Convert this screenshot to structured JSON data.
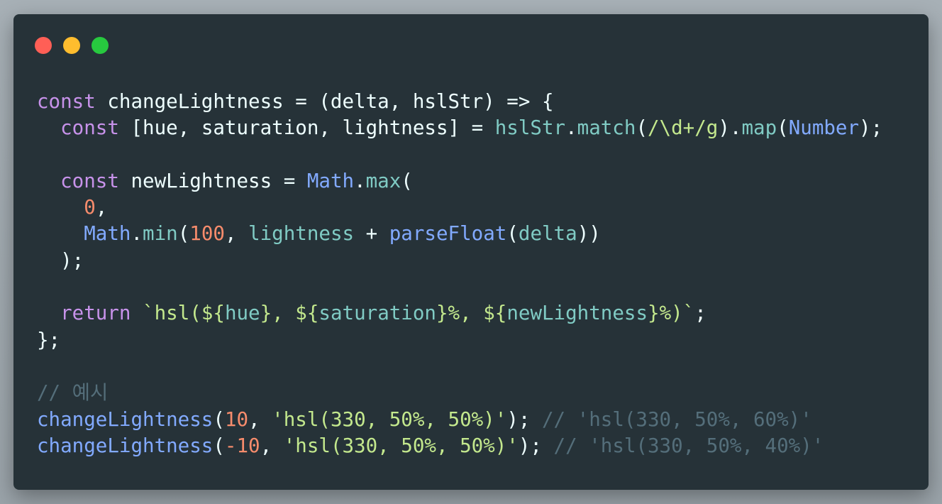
{
  "window": {
    "controls": [
      {
        "name": "close-button",
        "color": "#ff5f56"
      },
      {
        "name": "minimize-button",
        "color": "#ffbd2e"
      },
      {
        "name": "maximize-button",
        "color": "#27c93f"
      }
    ]
  },
  "colors": {
    "background": "#263238",
    "keyword": "#c792ea",
    "builtin": "#82aaff",
    "method": "#80cbc4",
    "number": "#f78c6c",
    "string": "#c3e88d",
    "comment": "#546e7a",
    "plain": "#eeffff"
  },
  "code": {
    "lines": [
      [
        {
          "t": "keyword",
          "v": "const"
        },
        {
          "t": "plain",
          "v": " changeLightness = (delta, hslStr) => {"
        }
      ],
      [
        {
          "t": "plain",
          "v": "  "
        },
        {
          "t": "keyword",
          "v": "const"
        },
        {
          "t": "plain",
          "v": " [hue, saturation, lightness] = "
        },
        {
          "t": "method",
          "v": "hslStr"
        },
        {
          "t": "plain",
          "v": "."
        },
        {
          "t": "method",
          "v": "match"
        },
        {
          "t": "plain",
          "v": "("
        },
        {
          "t": "string",
          "v": "/\\d+/g"
        },
        {
          "t": "plain",
          "v": ")."
        },
        {
          "t": "method",
          "v": "map"
        },
        {
          "t": "plain",
          "v": "("
        },
        {
          "t": "builtin",
          "v": "Number"
        },
        {
          "t": "plain",
          "v": ");"
        }
      ],
      [],
      [
        {
          "t": "plain",
          "v": "  "
        },
        {
          "t": "keyword",
          "v": "const"
        },
        {
          "t": "plain",
          "v": " newLightness = "
        },
        {
          "t": "builtin",
          "v": "Math"
        },
        {
          "t": "plain",
          "v": "."
        },
        {
          "t": "method",
          "v": "max"
        },
        {
          "t": "plain",
          "v": "("
        }
      ],
      [
        {
          "t": "plain",
          "v": "    "
        },
        {
          "t": "number",
          "v": "0"
        },
        {
          "t": "plain",
          "v": ","
        }
      ],
      [
        {
          "t": "plain",
          "v": "    "
        },
        {
          "t": "builtin",
          "v": "Math"
        },
        {
          "t": "plain",
          "v": "."
        },
        {
          "t": "method",
          "v": "min"
        },
        {
          "t": "plain",
          "v": "("
        },
        {
          "t": "number",
          "v": "100"
        },
        {
          "t": "plain",
          "v": ", "
        },
        {
          "t": "method",
          "v": "lightness"
        },
        {
          "t": "plain",
          "v": " + "
        },
        {
          "t": "builtin",
          "v": "parseFloat"
        },
        {
          "t": "plain",
          "v": "("
        },
        {
          "t": "method",
          "v": "delta"
        },
        {
          "t": "plain",
          "v": "))"
        }
      ],
      [
        {
          "t": "plain",
          "v": "  );"
        }
      ],
      [],
      [
        {
          "t": "plain",
          "v": "  "
        },
        {
          "t": "keyword",
          "v": "return"
        },
        {
          "t": "plain",
          "v": " "
        },
        {
          "t": "string",
          "v": "`hsl(${"
        },
        {
          "t": "method",
          "v": "hue"
        },
        {
          "t": "string",
          "v": "}, ${"
        },
        {
          "t": "method",
          "v": "saturation"
        },
        {
          "t": "string",
          "v": "}%, ${"
        },
        {
          "t": "method",
          "v": "newLightness"
        },
        {
          "t": "string",
          "v": "}%)`"
        },
        {
          "t": "plain",
          "v": ";"
        }
      ],
      [
        {
          "t": "plain",
          "v": "};"
        }
      ],
      [],
      [
        {
          "t": "comment",
          "v": "// 예시"
        }
      ],
      [
        {
          "t": "builtin",
          "v": "changeLightness"
        },
        {
          "t": "plain",
          "v": "("
        },
        {
          "t": "number",
          "v": "10"
        },
        {
          "t": "plain",
          "v": ", "
        },
        {
          "t": "string",
          "v": "'hsl(330, 50%, 50%)'"
        },
        {
          "t": "plain",
          "v": "); "
        },
        {
          "t": "comment",
          "v": "// 'hsl(330, 50%, 60%)'"
        }
      ],
      [
        {
          "t": "builtin",
          "v": "changeLightness"
        },
        {
          "t": "plain",
          "v": "("
        },
        {
          "t": "number",
          "v": "-10"
        },
        {
          "t": "plain",
          "v": ", "
        },
        {
          "t": "string",
          "v": "'hsl(330, 50%, 50%)'"
        },
        {
          "t": "plain",
          "v": "); "
        },
        {
          "t": "comment",
          "v": "// 'hsl(330, 50%, 40%)'"
        }
      ]
    ]
  }
}
